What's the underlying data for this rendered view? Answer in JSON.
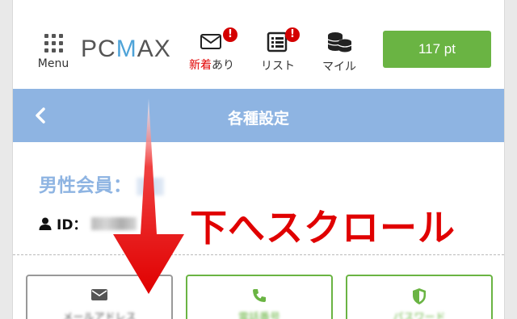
{
  "header": {
    "menu_label": "Menu",
    "logo_text_a": "PC",
    "logo_text_b": "M",
    "logo_text_c": "AX",
    "new_mail_label_red": "新着",
    "new_mail_label_rest": "あり",
    "new_mail_badge": "!",
    "list_label": "リスト",
    "list_badge": "!",
    "mile_label": "マイル",
    "points": "117 pt"
  },
  "titlebar": {
    "title": "各種設定"
  },
  "profile": {
    "member_label": "男性会員：",
    "id_label": "ID："
  },
  "annotation": {
    "text": "下へスクロール"
  },
  "buttons": [
    {
      "label": "メールアドレス",
      "icon": "envelope-icon"
    },
    {
      "label": "電話番号",
      "icon": "phone-icon"
    },
    {
      "label": "パスワード",
      "icon": "shield-icon"
    }
  ],
  "colors": {
    "accent_blue": "#8eb4e2",
    "green": "#6ab443",
    "red": "#e00000"
  }
}
